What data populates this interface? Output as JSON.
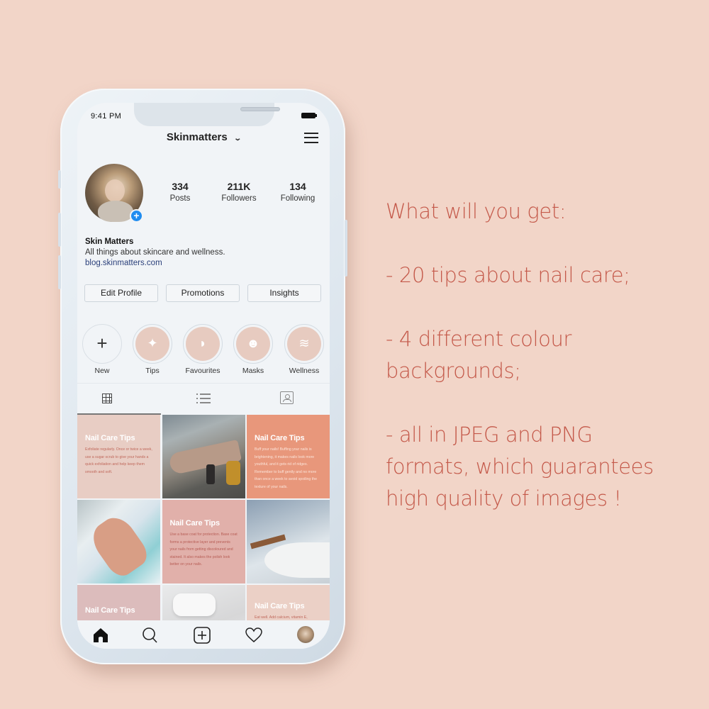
{
  "status_bar": {
    "time": "9:41 PM",
    "battery_icon": "battery-full-icon"
  },
  "header": {
    "username": "Skinmatters",
    "dropdown_icon": "chevron-down-icon",
    "menu_icon": "hamburger-menu-icon"
  },
  "profile": {
    "avatar_icon": "profile-photo",
    "add_story_icon": "plus-circle-icon",
    "add_symbol": "+",
    "stats": [
      {
        "value": "334",
        "label": "Posts"
      },
      {
        "value": "211K",
        "label": "Followers"
      },
      {
        "value": "134",
        "label": "Following"
      }
    ],
    "name": "Skin Matters",
    "bio": "All things about skincare and wellness.",
    "link": "blog.skinmatters.com"
  },
  "buttons": {
    "edit_profile": "Edit Profile",
    "promotions": "Promotions",
    "insights": "Insights"
  },
  "highlights": [
    {
      "label": "New",
      "icon": "+"
    },
    {
      "label": "Tips",
      "icon": "✦"
    },
    {
      "label": "Favourites",
      "icon": "◗"
    },
    {
      "label": "Masks",
      "icon": "☻"
    },
    {
      "label": "Wellness",
      "icon": "≋"
    }
  ],
  "tabs": [
    {
      "name": "grid",
      "icon": "grid-icon",
      "active": true
    },
    {
      "name": "list",
      "icon": "list-icon",
      "active": false
    },
    {
      "name": "tagged",
      "icon": "tagged-icon",
      "active": false
    }
  ],
  "feed": {
    "tiles": [
      {
        "type": "tip",
        "title": "Nail Care Tips",
        "text": "Exfoliate regularly. Once or twice a week, use a sugar scrub to give your hands a quick exfoliation and help keep them smooth and soft.",
        "color": "#e8cdc4"
      },
      {
        "type": "photo",
        "subject": "hand with oil bottles"
      },
      {
        "type": "tip",
        "title": "Nail Care Tips",
        "text": "Buff your nails! Buffing your nails is brightening, it makes nails look more youthful, and it gets rid of ridges. Remember to buff gently and no more than once a week to avoid spoiling the texture of your nails.",
        "color": "#e8977b"
      },
      {
        "type": "photo",
        "subject": "hands with coral nail polish"
      },
      {
        "type": "tip",
        "title": "Nail Care Tips",
        "text": "Use a base coat for protection. Base coat forms a protective layer and prevents your nails from getting discoloured and stained. It also makes the polish look better on your nails.",
        "color": "#e1b0aa"
      },
      {
        "type": "photo",
        "subject": "bathtub by window"
      },
      {
        "type": "tip",
        "title": "Nail Care Tips",
        "text": "",
        "color": "#dcbcbc"
      },
      {
        "type": "photo",
        "subject": "white pillows on bed"
      },
      {
        "type": "tip",
        "title": "Nail Care Tips",
        "text": "Eat well. Add calcium, vitamin E,",
        "color": "#ebd0c6"
      }
    ]
  },
  "bottom_nav": [
    {
      "name": "home",
      "icon": "home-icon"
    },
    {
      "name": "search",
      "icon": "search-icon"
    },
    {
      "name": "new-post",
      "icon": "add-post-icon"
    },
    {
      "name": "activity",
      "icon": "heart-icon"
    },
    {
      "name": "profile",
      "icon": "profile-avatar-icon"
    }
  ],
  "promo": {
    "heading": "What will you get:",
    "items": [
      "- 20 tips about nail care;",
      "- 4 different colour backgrounds;",
      "- all in JPEG and PNG formats, which guarantees high quality of images !"
    ],
    "text_color": "#c4594a",
    "background_color": "#f2d5c8"
  }
}
